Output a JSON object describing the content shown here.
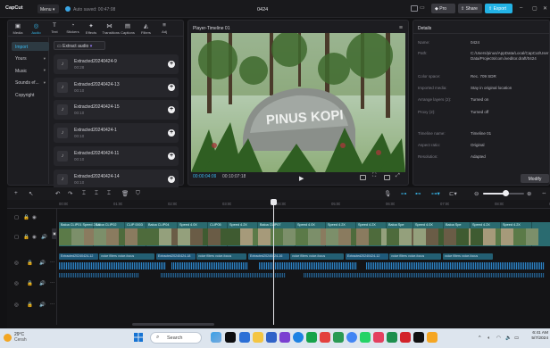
{
  "app": {
    "logo": "CapCut",
    "menu_label": "Menu",
    "autosave_text": "Auto saved: 00:47:08",
    "project_name": "0424",
    "pro_label": "Pro",
    "share_label": "Share",
    "export_label": "Export"
  },
  "media_toolbar": [
    {
      "label": "Media",
      "icon": "media-icon",
      "glyph": "▣"
    },
    {
      "label": "Audio",
      "icon": "audio-icon",
      "glyph": "◎"
    },
    {
      "label": "Text",
      "icon": "text-icon",
      "glyph": "T"
    },
    {
      "label": "Stickers",
      "icon": "sticker-icon",
      "glyph": "◔"
    },
    {
      "label": "Effects",
      "icon": "effects-icon",
      "glyph": "✦"
    },
    {
      "label": "Transitions",
      "icon": "transitions-icon",
      "glyph": "⋈"
    },
    {
      "label": "Captions",
      "icon": "captions-icon",
      "glyph": "▤"
    },
    {
      "label": "Filters",
      "icon": "filters-icon",
      "glyph": "◭"
    },
    {
      "label": "Adj",
      "icon": "adjust-icon",
      "glyph": "≡"
    }
  ],
  "sidebar": [
    {
      "label": "Import",
      "active": true
    },
    {
      "label": "Yours",
      "chev": true
    },
    {
      "label": "Music",
      "chev": true
    },
    {
      "label": "Sounds ef...",
      "chev": true
    },
    {
      "label": "Copyright"
    }
  ],
  "extract_audio_label": "Extract audio",
  "media_items": [
    {
      "name": "Extracted20240424-9",
      "duration": "00:28"
    },
    {
      "name": "Extracted20240424-13",
      "duration": "00:10"
    },
    {
      "name": "Extracted20240424-15",
      "duration": "00:10"
    },
    {
      "name": "Extracted20240424-1",
      "duration": "00:10"
    },
    {
      "name": "Extracted20240424-11",
      "duration": "00:10"
    },
    {
      "name": "Extracted20240424-14",
      "duration": "00:10"
    }
  ],
  "player": {
    "title": "Player-Timeline 01",
    "sign_text": "PINUS KOPI",
    "current_time": "00:00:04:09",
    "total_time": "00:10:07:18"
  },
  "details": {
    "title": "Details",
    "rows": [
      {
        "label": "Name:",
        "value": "0424"
      },
      {
        "label": "Path:",
        "value": "C:/Users/pinus/AppData/Local/CapCut/User Data/Projects/com.lveditor.draft/0424"
      },
      {
        "label": "Color space:",
        "value": "Rec. 709 SDR"
      },
      {
        "label": "Imported media:",
        "value": "Stay in original location"
      },
      {
        "label": "Arrange layers (2):",
        "value": "Turned on"
      },
      {
        "label": "Proxy (2):",
        "value": "Turned off"
      },
      {
        "label": "Timeline name:",
        "value": "Timeline 01"
      },
      {
        "label": "Aspect ratio:",
        "value": "Original"
      },
      {
        "label": "Resolution:",
        "value": "Adapted"
      }
    ],
    "modify_label": "Modify"
  },
  "ruler_ticks": [
    "00:00",
    "01:00",
    "02:00",
    "03:00",
    "04:00",
    "05:00",
    "06:00",
    "07:00",
    "08:00",
    "09:00"
  ],
  "video_clips": [
    {
      "label": "Baloa  CLIP01  Speed 2.1X",
      "width": 39
    },
    {
      "label": "Baloa  CLIP02",
      "width": 35
    },
    {
      "label": "CLIP 0003",
      "width": 24
    },
    {
      "label": "Baloa  CLIP04",
      "width": 35
    },
    {
      "label": "Speed 4.0X",
      "width": 34
    },
    {
      "label": "CLIP05",
      "width": 22
    },
    {
      "label": "Speed 4.2X",
      "width": 34
    },
    {
      "label": "Baloa CLIP07",
      "width": 42
    },
    {
      "label": "Speed 4.0X",
      "width": 34
    },
    {
      "label": "Speed 4.2X",
      "width": 34
    },
    {
      "label": "Speed 4.2X",
      "width": 34
    },
    {
      "label": "Baloa  Spe",
      "width": 30
    },
    {
      "label": "Speed 4.0X",
      "width": 34
    },
    {
      "label": "Baloa  Spe",
      "width": 30
    },
    {
      "label": "Speed 4.2X",
      "width": 34
    },
    {
      "label": "Speed 4.2X",
      "width": 35
    }
  ],
  "audio_row1": [
    {
      "label": "Extracted20240424-12",
      "width": 44,
      "gap": 1
    },
    {
      "label": "voice filters  voice-focus",
      "width": 62,
      "gap": 2
    },
    {
      "label": "Extracted20240424-18",
      "width": 44,
      "gap": 1
    },
    {
      "label": "voice filters  voice-focus",
      "width": 56,
      "gap": 2
    },
    {
      "label": "Extracted20240424-16",
      "width": 46,
      "gap": 1
    },
    {
      "label": "voice filters  voice-focus",
      "width": 60,
      "gap": 2
    },
    {
      "label": "Extracted20240424-12",
      "width": 48,
      "gap": 1
    },
    {
      "label": "voice filters  voice-focus",
      "width": 58,
      "gap": 2
    },
    {
      "label": "voice filters  voice-focus",
      "width": 56,
      "gap": 2
    }
  ],
  "taskbar": {
    "weather_temp": "29°C",
    "weather_desc": "Cerah",
    "search_label": "Search",
    "time": "6:41 AM",
    "date": "5/7/2024"
  }
}
